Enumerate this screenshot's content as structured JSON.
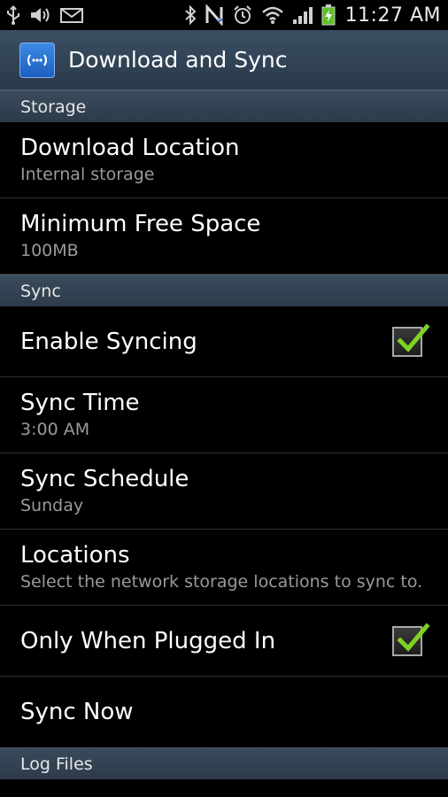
{
  "status_bar": {
    "time": "11:27 AM",
    "icons_left": [
      "usb-icon",
      "volume-icon",
      "mail-icon"
    ],
    "icons_right": [
      "bluetooth-icon",
      "nfc-icon",
      "alarm-icon",
      "wifi-icon",
      "signal-icon",
      "battery-charging-icon"
    ]
  },
  "action_bar": {
    "title": "Download and Sync",
    "icon": "app-wireless-icon"
  },
  "sections": {
    "storage": {
      "header": "Storage",
      "download_location": {
        "title": "Download Location",
        "summary": "Internal storage"
      },
      "min_free_space": {
        "title": "Minimum Free Space",
        "summary": "100MB"
      }
    },
    "sync": {
      "header": "Sync",
      "enable_syncing": {
        "title": "Enable Syncing",
        "checked": true
      },
      "sync_time": {
        "title": "Sync Time",
        "summary": "3:00 AM"
      },
      "sync_schedule": {
        "title": "Sync Schedule",
        "summary": "Sunday"
      },
      "locations": {
        "title": "Locations",
        "summary": "Select the network storage locations to sync to."
      },
      "only_plugged": {
        "title": "Only When Plugged In",
        "checked": true
      },
      "sync_now": {
        "title": "Sync Now"
      }
    },
    "log_files": {
      "header": "Log Files"
    }
  },
  "colors": {
    "check_green": "#7ed321",
    "section_bg": "#34475a",
    "summary_text": "#9a9a9a"
  }
}
